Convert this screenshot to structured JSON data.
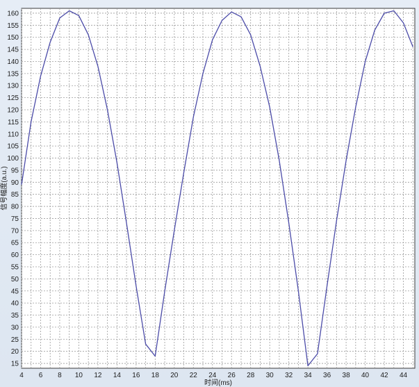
{
  "chart_data": {
    "type": "line",
    "xlabel": "时间(ms)",
    "ylabel": "信号幅度(a.u.)",
    "xlim": [
      4,
      45.2
    ],
    "ylim": [
      13,
      162
    ],
    "x_ticks": [
      4,
      6,
      8,
      10,
      12,
      14,
      16,
      18,
      20,
      22,
      24,
      26,
      28,
      30,
      32,
      34,
      36,
      38,
      40,
      42,
      44
    ],
    "y_ticks": [
      15,
      20,
      25,
      30,
      35,
      40,
      45,
      50,
      55,
      60,
      65,
      70,
      75,
      80,
      85,
      90,
      95,
      100,
      105,
      110,
      115,
      120,
      125,
      130,
      135,
      140,
      145,
      150,
      155,
      160
    ],
    "grid": true,
    "series": [
      {
        "color": "#4b4ba8",
        "x": [
          4,
          5,
          6,
          7,
          8,
          9,
          10,
          11,
          12,
          13,
          14,
          15,
          16,
          17,
          18,
          19,
          20,
          21,
          22,
          23,
          24,
          25,
          26,
          27,
          28,
          29,
          30,
          31,
          32,
          33,
          34,
          35,
          36,
          37,
          38,
          39,
          40,
          41,
          42,
          43,
          44,
          45
        ],
        "y": [
          89,
          115,
          134,
          148,
          158,
          161,
          159,
          151,
          138,
          120,
          98,
          73,
          47,
          23,
          18,
          45,
          70,
          94,
          117,
          135,
          149,
          157,
          160.5,
          158.5,
          151,
          138,
          121,
          99,
          73,
          45,
          14,
          19,
          47,
          74,
          99,
          121,
          140,
          153,
          160,
          161,
          156,
          146
        ]
      }
    ]
  }
}
